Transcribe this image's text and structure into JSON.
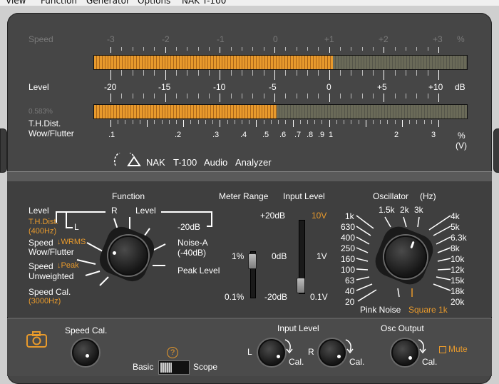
{
  "menu": [
    "View",
    "Function",
    "Generator",
    "Options",
    "NAK T-100"
  ],
  "meters": {
    "speed": {
      "label": "Speed",
      "ticks": [
        "-3",
        "-2",
        "-1",
        "0",
        "+1",
        "+2",
        "+3"
      ],
      "unit": "%",
      "fill_fraction": 0.64
    },
    "level": {
      "label": "Level",
      "ticks": [
        "-20",
        "-15",
        "-10",
        "-5",
        "0",
        "+5",
        "+10"
      ],
      "unit": "dB"
    },
    "thd": {
      "readout": "0.583%",
      "label1": "T.H.Dist.",
      "label2": "Wow/Flutter",
      "fill_fraction": 0.49,
      "ticks": [
        ".1",
        ".2",
        ".3",
        ".4",
        ".5",
        ".6",
        ".7",
        ".8",
        ".9",
        "1",
        "2",
        "3"
      ],
      "unit1": "%",
      "unit2": "(V)"
    }
  },
  "brand": {
    "nak": "NAK",
    "model": "T-100",
    "w1": "Audio",
    "w2": "Analyzer"
  },
  "function": {
    "title": "Function",
    "level": "Level",
    "r": "R",
    "level2": "Level",
    "l": "L",
    "thd": "T.H.Dist.",
    "thd_hz": "(400Hz)",
    "speed": "Speed",
    "wrms": "↓WRMS",
    "wow": "Wow/Flutter",
    "speed2": "Speed",
    "peak": "↓Peak",
    "unweighted": "Unweighted",
    "speedcal": "Speed Cal.",
    "speedcal_hz": "(3000Hz)",
    "minus20": "-20dB",
    "noise": "Noise-A",
    "noise2": "(-40dB)",
    "peaklevel": "Peak Level"
  },
  "meter_range": {
    "title": "Meter Range",
    "top": "1%",
    "mid": "0dB",
    "bottom": "0.1%",
    "plus20": "+20dB",
    "minus20": "-20dB"
  },
  "input_level": {
    "title": "Input Level",
    "v10": "10V",
    "v1": "1V",
    "v01": "0.1V"
  },
  "oscillator": {
    "title": "Oscillator",
    "unit": "(Hz)",
    "left": [
      "1k",
      "630",
      "400",
      "250",
      "160",
      "100",
      "63",
      "40",
      "20"
    ],
    "top": [
      "1.5k",
      "2k",
      "3k"
    ],
    "right": [
      "4k",
      "5k",
      "6.3k",
      "8k",
      "10k",
      "12k",
      "15k",
      "18k",
      "20k"
    ],
    "pink": "Pink Noise",
    "square": "Square 1k"
  },
  "bottom": {
    "speedcal": "Speed Cal.",
    "basic": "Basic",
    "scope": "Scope",
    "help": "?",
    "input_level": "Input Level",
    "l": "L",
    "r": "R",
    "cal": "Cal.",
    "osc_output": "Osc Output",
    "mute": "Mute",
    "cal2": "Cal."
  },
  "colors": {
    "panel": "#464646",
    "accent": "#e89a2c",
    "text": "#ffffff",
    "dim": "#7a7a7a"
  }
}
